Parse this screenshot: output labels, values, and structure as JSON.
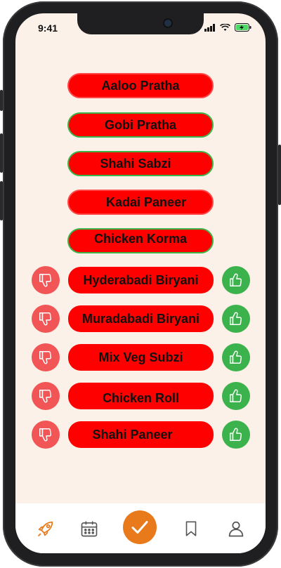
{
  "status": {
    "time": "9:41"
  },
  "menu_items": [
    {
      "label": "Aaloo Pratha"
    },
    {
      "label": "Gobi Pratha"
    },
    {
      "label": "Shahi Sabzi"
    },
    {
      "label": "Kadai Paneer"
    },
    {
      "label": "Chicken Korma"
    }
  ],
  "votable_items": [
    {
      "label": "Hyderabadi Biryani"
    },
    {
      "label": "Muradabadi Biryani"
    },
    {
      "label": "Mix Veg Subzi"
    },
    {
      "label": "Chicken Roll"
    },
    {
      "label": "Shahi Paneer"
    }
  ],
  "nav": {
    "items": [
      "rocket-icon",
      "calendar-icon",
      "check-icon",
      "bookmark-icon",
      "profile-icon"
    ],
    "accent": "#e87a1c"
  },
  "colors": {
    "pill": "#ff0000",
    "thumb_up": "#3bb24b",
    "thumb_down": "#f25555",
    "background": "#fbf1e8"
  }
}
